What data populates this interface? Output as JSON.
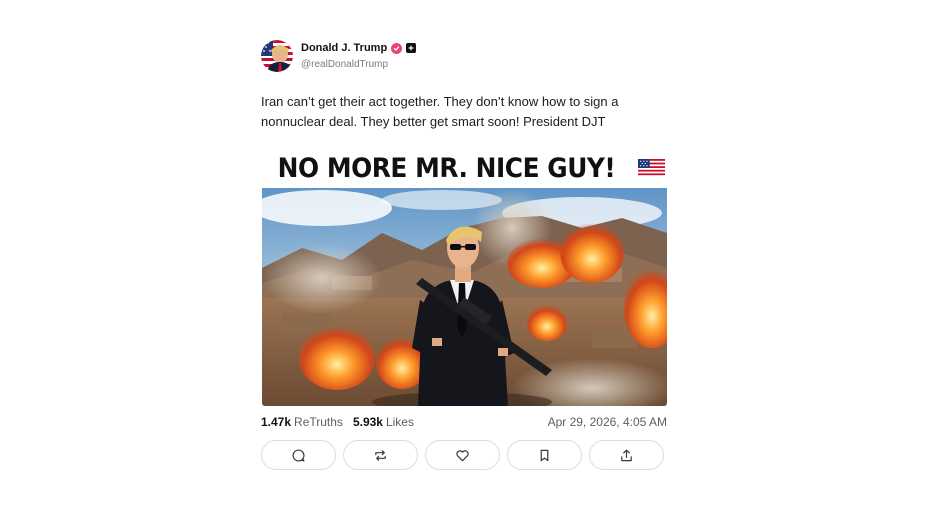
{
  "post": {
    "author": {
      "display_name": "Donald J. Trump",
      "handle": "@realDonaldTrump",
      "verified_badge_color": "#e8456f",
      "icons": [
        "verified-badge-icon",
        "plus-badge-icon"
      ]
    },
    "text": "Iran can’t get their act together. They don’t know how to sign a nonnuclear deal. They better get smart soon! President DJT",
    "media": {
      "headline": "NO MORE MR. NICE GUY!",
      "flag_icon": "us-flag-icon"
    },
    "stats": {
      "retruths_count": "1.47k",
      "retruths_label": "ReTruths",
      "likes_count": "5.93k",
      "likes_label": "Likes",
      "timestamp": "Apr 29, 2026, 4:05 AM"
    },
    "actions": [
      "reply-icon",
      "retruth-icon",
      "like-icon",
      "bookmark-icon",
      "share-icon"
    ]
  }
}
